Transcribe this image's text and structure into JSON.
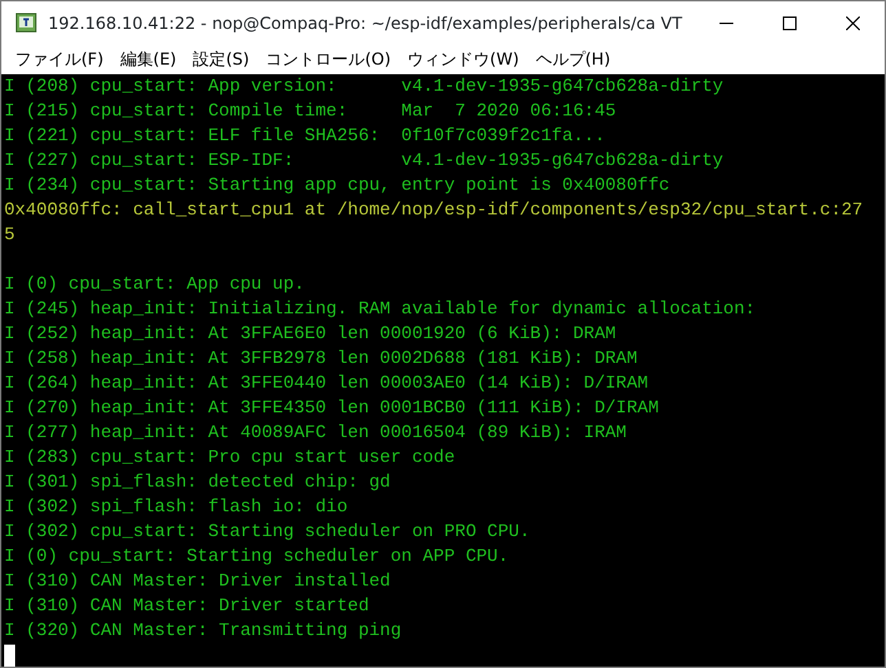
{
  "window": {
    "title": "192.168.10.41:22 - nop@Compaq-Pro: ~/esp-idf/examples/peripherals/ca VT"
  },
  "menu": [
    "ファイル(F)",
    "編集(E)",
    "設定(S)",
    "コントロール(O)",
    "ウィンドウ(W)",
    "ヘルプ(H)"
  ],
  "terminal": {
    "lines": [
      {
        "kind": "text",
        "text": "I (208) cpu_start: App version:      v4.1-dev-1935-g647cb628a-dirty",
        "color": "#1fbf1f"
      },
      {
        "kind": "text",
        "text": "I (215) cpu_start: Compile time:     Mar  7 2020 06:16:45",
        "color": "#1fbf1f"
      },
      {
        "kind": "text",
        "text": "I (221) cpu_start: ELF file SHA256:  0f10f7c039f2c1fa...",
        "color": "#1fbf1f"
      },
      {
        "kind": "text",
        "text": "I (227) cpu_start: ESP-IDF:          v4.1-dev-1935-g647cb628a-dirty",
        "color": "#1fbf1f"
      },
      {
        "kind": "text",
        "text": "I (234) cpu_start: Starting app cpu, entry point is 0x40080ffc",
        "color": "#1fbf1f"
      },
      {
        "kind": "text",
        "text": "0x40080ffc: call_start_cpu1 at /home/nop/esp-idf/components/esp32/cpu_start.c:27",
        "color": "#b8c83a"
      },
      {
        "kind": "text",
        "text": "5",
        "color": "#b8c83a"
      },
      {
        "kind": "blank"
      },
      {
        "kind": "text",
        "text": "I (0) cpu_start: App cpu up.",
        "color": "#1fbf1f"
      },
      {
        "kind": "text",
        "text": "I (245) heap_init: Initializing. RAM available for dynamic allocation:",
        "color": "#1fbf1f"
      },
      {
        "kind": "text",
        "text": "I (252) heap_init: At 3FFAE6E0 len 00001920 (6 KiB): DRAM",
        "color": "#1fbf1f"
      },
      {
        "kind": "text",
        "text": "I (258) heap_init: At 3FFB2978 len 0002D688 (181 KiB): DRAM",
        "color": "#1fbf1f"
      },
      {
        "kind": "text",
        "text": "I (264) heap_init: At 3FFE0440 len 00003AE0 (14 KiB): D/IRAM",
        "color": "#1fbf1f"
      },
      {
        "kind": "text",
        "text": "I (270) heap_init: At 3FFE4350 len 0001BCB0 (111 KiB): D/IRAM",
        "color": "#1fbf1f"
      },
      {
        "kind": "text",
        "text": "I (277) heap_init: At 40089AFC len 00016504 (89 KiB): IRAM",
        "color": "#1fbf1f"
      },
      {
        "kind": "text",
        "text": "I (283) cpu_start: Pro cpu start user code",
        "color": "#1fbf1f"
      },
      {
        "kind": "text",
        "text": "I (301) spi_flash: detected chip: gd",
        "color": "#1fbf1f"
      },
      {
        "kind": "text",
        "text": "I (302) spi_flash: flash io: dio",
        "color": "#1fbf1f"
      },
      {
        "kind": "text",
        "text": "I (302) cpu_start: Starting scheduler on PRO CPU.",
        "color": "#1fbf1f"
      },
      {
        "kind": "text",
        "text": "I (0) cpu_start: Starting scheduler on APP CPU.",
        "color": "#1fbf1f"
      },
      {
        "kind": "text",
        "text": "I (310) CAN Master: Driver installed",
        "color": "#1fbf1f"
      },
      {
        "kind": "text",
        "text": "I (310) CAN Master: Driver started",
        "color": "#1fbf1f"
      },
      {
        "kind": "text",
        "text": "I (320) CAN Master: Transmitting ping",
        "color": "#1fbf1f"
      },
      {
        "kind": "cursor"
      }
    ]
  }
}
